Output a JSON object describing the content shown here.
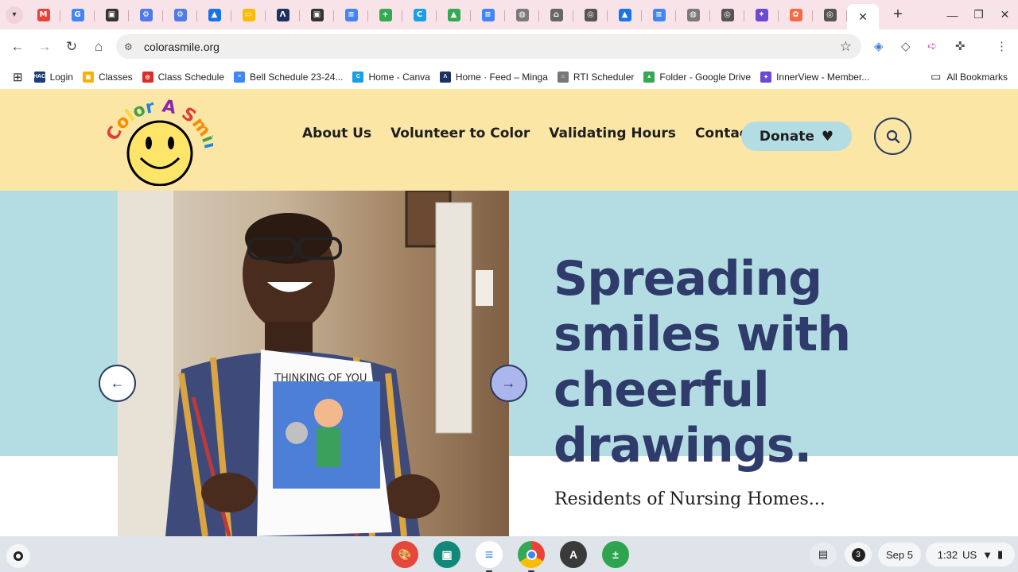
{
  "browser": {
    "url": "colorasmile.org",
    "tabs": [
      {
        "icon": "gmail-icon",
        "color": "#ea4335",
        "glyph": "M"
      },
      {
        "icon": "google-icon",
        "color": "#4285f4",
        "glyph": "G"
      },
      {
        "icon": "classroom-icon",
        "color": "#333333",
        "glyph": "▣"
      },
      {
        "icon": "bot-icon",
        "color": "#4f7be8",
        "glyph": "⚙"
      },
      {
        "icon": "bot-icon",
        "color": "#4f7be8",
        "glyph": "⚙"
      },
      {
        "icon": "contacts-icon",
        "color": "#1a73e8",
        "glyph": "▲"
      },
      {
        "icon": "slides-icon",
        "color": "#fbbc04",
        "glyph": "▭"
      },
      {
        "icon": "minga-icon",
        "color": "#1d3160",
        "glyph": "Λ"
      },
      {
        "icon": "classroom-icon",
        "color": "#333333",
        "glyph": "▣"
      },
      {
        "icon": "docs-icon",
        "color": "#4285f4",
        "glyph": "≡"
      },
      {
        "icon": "sheets-add-icon",
        "color": "#34a853",
        "glyph": "+"
      },
      {
        "icon": "canva-icon",
        "color": "#1a9ee6",
        "glyph": "C"
      },
      {
        "icon": "drive-icon",
        "color": "#34a853",
        "glyph": "▲"
      },
      {
        "icon": "docs-icon",
        "color": "#4285f4",
        "glyph": "≡"
      },
      {
        "icon": "globe-icon",
        "color": "#7a7a7a",
        "glyph": "◍"
      },
      {
        "icon": "graduation-cap-icon",
        "color": "#666666",
        "glyph": "⌂"
      },
      {
        "icon": "chrome-icon",
        "color": "#555555",
        "glyph": "◎"
      },
      {
        "icon": "contacts-icon",
        "color": "#1a73e8",
        "glyph": "▲"
      },
      {
        "icon": "docs-icon",
        "color": "#4285f4",
        "glyph": "≡"
      },
      {
        "icon": "globe-icon",
        "color": "#7a7a7a",
        "glyph": "◍"
      },
      {
        "icon": "chrome-icon",
        "color": "#555555",
        "glyph": "◎"
      },
      {
        "icon": "innerview-icon",
        "color": "#6a4bd1",
        "glyph": "✦"
      },
      {
        "icon": "app-icon",
        "color": "#f46b45",
        "glyph": "✿"
      },
      {
        "icon": "chrome-icon",
        "color": "#555555",
        "glyph": "◎"
      }
    ],
    "bookmarks": [
      {
        "label": "Login",
        "icon": "hac-icon",
        "color": "#1d3a7a",
        "glyph": "HAC"
      },
      {
        "label": "Classes",
        "icon": "classroom-icon",
        "color": "#f4b400",
        "glyph": "▣"
      },
      {
        "label": "Class Schedule",
        "icon": "target-icon",
        "color": "#d93025",
        "glyph": "◎"
      },
      {
        "label": "Bell Schedule 23-24...",
        "icon": "docs-icon",
        "color": "#4285f4",
        "glyph": "≡"
      },
      {
        "label": "Home - Canva",
        "icon": "canva-icon",
        "color": "#1a9ee6",
        "glyph": "C"
      },
      {
        "label": "Home · Feed – Minga",
        "icon": "minga-icon",
        "color": "#1d3160",
        "glyph": "Λ"
      },
      {
        "label": "RTI Scheduler",
        "icon": "graduation-cap-icon",
        "color": "#777777",
        "glyph": "⌂"
      },
      {
        "label": "Folder - Google Drive",
        "icon": "drive-icon",
        "color": "#34a853",
        "glyph": "▲"
      },
      {
        "label": "InnerView - Member...",
        "icon": "innerview-icon",
        "color": "#6a4bd1",
        "glyph": "✦"
      }
    ],
    "all_bookmarks": "All Bookmarks"
  },
  "site": {
    "logo_text": "Color A Smile",
    "nav": [
      "About Us",
      "Volunteer to Color",
      "Validating Hours",
      "Contact"
    ],
    "donate": "Donate",
    "headline": "Spreading smiles with cheerful drawings.",
    "subtext": "Residents of Nursing Homes...",
    "drawing_caption": "THINKING OF YOU"
  },
  "shelf": {
    "notifications": "3",
    "date": "Sep 5",
    "time": "1:32",
    "locale": "US"
  }
}
